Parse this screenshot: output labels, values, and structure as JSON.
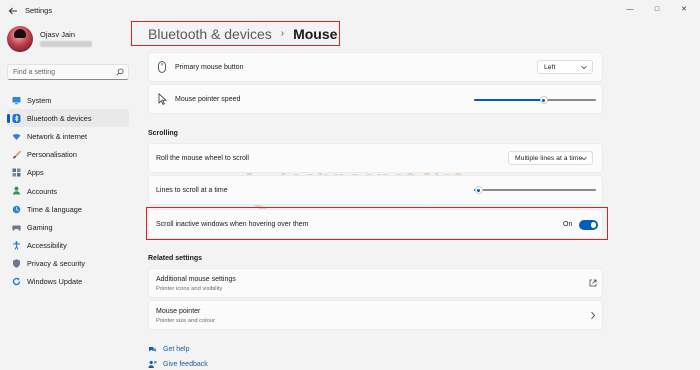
{
  "window": {
    "title": "Settings",
    "minimize": "—",
    "maximize": "□",
    "close": "✕"
  },
  "profile": {
    "name": "Ojasv Jain"
  },
  "search": {
    "placeholder": "Find a setting"
  },
  "sidebar": {
    "items": [
      {
        "label": "System",
        "icon": "monitor-icon",
        "color": "#2b88d8"
      },
      {
        "label": "Bluetooth & devices",
        "icon": "bluetooth-icon",
        "color": "#1a74d1",
        "active": true
      },
      {
        "label": "Network & internet",
        "icon": "wifi-icon",
        "color": "#3a7bd5"
      },
      {
        "label": "Personalisation",
        "icon": "brush-icon",
        "color": "#d48a3a"
      },
      {
        "label": "Apps",
        "icon": "apps-icon",
        "color": "#5a6f8a"
      },
      {
        "label": "Accounts",
        "icon": "person-icon",
        "color": "#2e9a5a"
      },
      {
        "label": "Time & language",
        "icon": "clock-globe-icon",
        "color": "#2b88d8"
      },
      {
        "label": "Gaming",
        "icon": "gamepad-icon",
        "color": "#6b7a8a"
      },
      {
        "label": "Accessibility",
        "icon": "accessibility-icon",
        "color": "#1a74d1"
      },
      {
        "label": "Privacy & security",
        "icon": "shield-icon",
        "color": "#6b7a8a"
      },
      {
        "label": "Windows Update",
        "icon": "update-icon",
        "color": "#1a74d1"
      }
    ]
  },
  "breadcrumb": {
    "parent": "Bluetooth & devices",
    "separator": "›",
    "current": "Mouse"
  },
  "settings": {
    "primary_button": {
      "label": "Primary mouse button",
      "value": "Left"
    },
    "pointer_speed": {
      "label": "Mouse pointer speed",
      "level": 0.57
    },
    "scrolling_header": "Scrolling",
    "roll_wheel": {
      "label": "Roll the mouse wheel to scroll",
      "value": "Multiple lines at a time"
    },
    "lines_to_scroll": {
      "label": "Lines to scroll at a time",
      "level": 0.04
    },
    "scroll_inactive": {
      "label": "Scroll inactive windows when hovering over them",
      "state": "On",
      "enabled": true
    }
  },
  "related": {
    "header": "Related settings",
    "items": [
      {
        "title": "Additional mouse settings",
        "subtitle": "Pointer icons and visibility",
        "icon": "external-link-icon"
      },
      {
        "title": "Mouse pointer",
        "subtitle": "Pointer size and colour",
        "icon": "chevron-right-icon"
      }
    ]
  },
  "help": {
    "get_help": "Get help",
    "give_feedback": "Give feedback"
  },
  "watermark": {
    "main": "Technospot",
    "suffix": ".Net",
    "sub": "@TSNW"
  },
  "colors": {
    "accent": "#005fb8",
    "highlight": "#e02020"
  }
}
